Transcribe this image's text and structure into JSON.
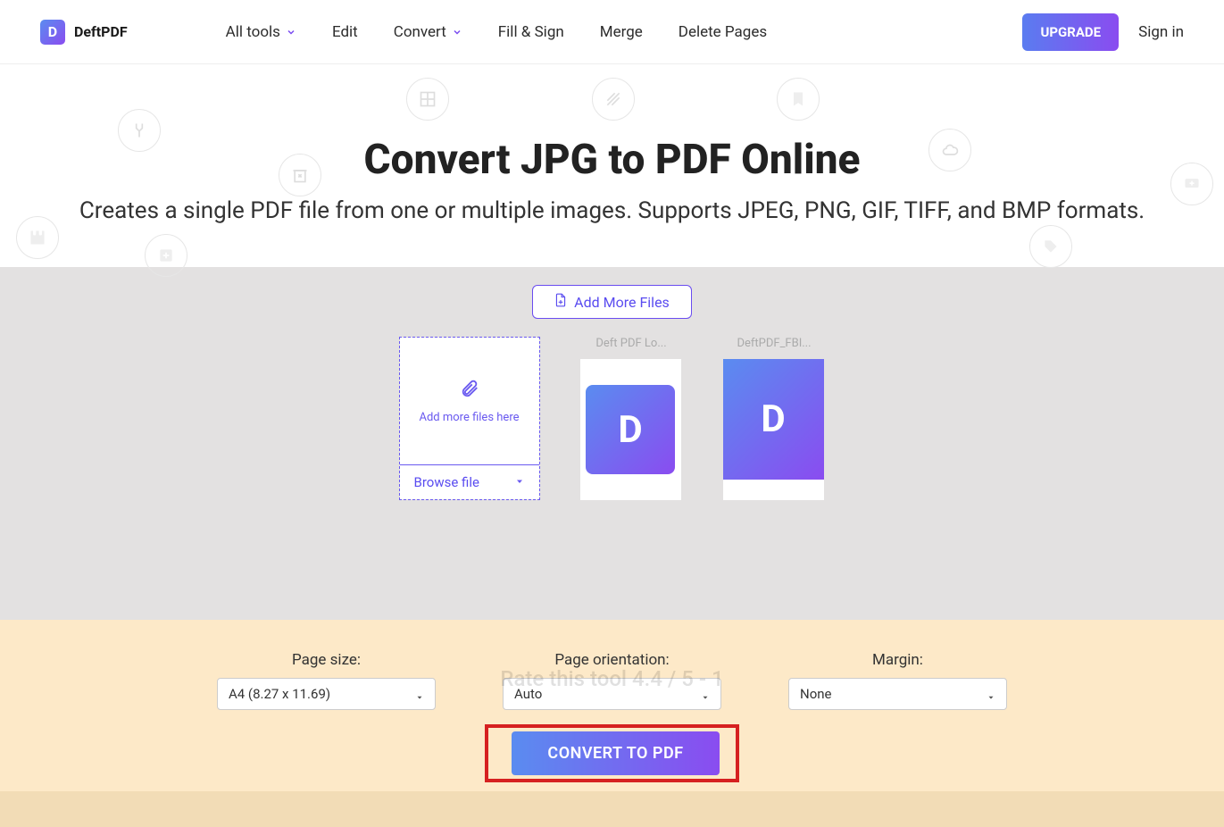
{
  "brand": "DeftPDF",
  "logo_letter": "D",
  "nav": {
    "all_tools": "All tools",
    "edit": "Edit",
    "convert": "Convert",
    "fill_sign": "Fill & Sign",
    "merge": "Merge",
    "delete_pages": "Delete Pages"
  },
  "header": {
    "upgrade": "UPGRADE",
    "signin": "Sign in"
  },
  "hero": {
    "title": "Convert JPG to PDF Online",
    "subtitle": "Creates a single PDF file from one or multiple images. Supports JPEG, PNG, GIF, TIFF, and BMP formats."
  },
  "workspace": {
    "add_more_files": "Add More Files",
    "upload_hint": "Add more files here",
    "browse": "Browse file",
    "files": [
      {
        "name": "Deft PDF Lo...",
        "letter": "D"
      },
      {
        "name": "DeftPDF_FBI...",
        "letter": "D"
      }
    ]
  },
  "controls": {
    "page_size": {
      "label": "Page size:",
      "value": "A4 (8.27 x 11.69)"
    },
    "orientation": {
      "label": "Page orientation:",
      "value": "Auto"
    },
    "margin": {
      "label": "Margin:",
      "value": "None"
    }
  },
  "rate_ghost": "Rate this tool                4.4 / 5 - 1",
  "convert_label": "CONVERT TO PDF"
}
